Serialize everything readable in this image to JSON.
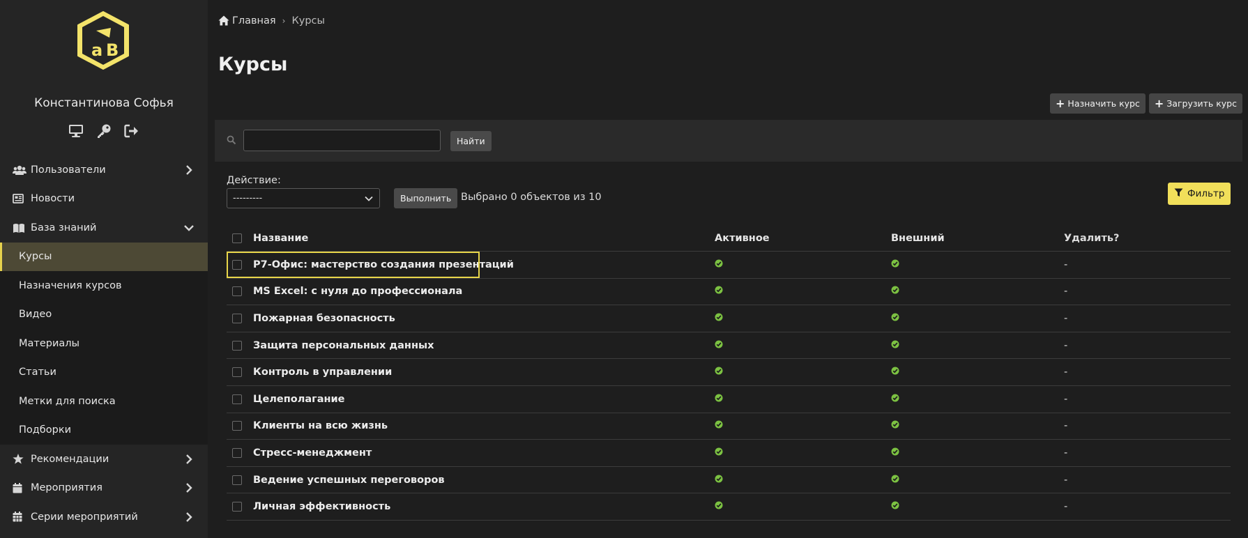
{
  "sidebar": {
    "username": "Константинова Софья",
    "user_icons": [
      "desktop-icon",
      "key-icon",
      "sign-out-icon"
    ],
    "items_top": [
      {
        "label": "Пользователи",
        "icon": "users-icon",
        "chevron": "right"
      },
      {
        "label": "Новости",
        "icon": "newspaper-icon",
        "chevron": ""
      },
      {
        "label": "База знаний",
        "icon": "book-icon",
        "chevron": "down"
      }
    ],
    "sub_items": [
      {
        "label": "Курсы",
        "active": true
      },
      {
        "label": "Назначения курсов",
        "active": false
      },
      {
        "label": "Видео",
        "active": false
      },
      {
        "label": "Материалы",
        "active": false
      },
      {
        "label": "Статьи",
        "active": false
      },
      {
        "label": "Метки для поиска",
        "active": false
      },
      {
        "label": "Подборки",
        "active": false
      }
    ],
    "items_bottom": [
      {
        "label": "Рекомендации",
        "icon": "star-icon",
        "chevron": "right"
      },
      {
        "label": "Мероприятия",
        "icon": "calendar-icon",
        "chevron": "right"
      },
      {
        "label": "Серии мероприятий",
        "icon": "calendar-grid-icon",
        "chevron": "right"
      }
    ]
  },
  "breadcrumb": {
    "home": "Главная",
    "separator": "›",
    "current": "Курсы"
  },
  "page_title": "Курсы",
  "actions": {
    "assign_course": "Назначить курс",
    "upload_course": "Загрузить курс"
  },
  "search": {
    "value": "",
    "button": "Найти"
  },
  "bulk": {
    "label": "Действие:",
    "selected_value": "---------",
    "run_button": "Выполнить",
    "selected_text": "Выбрано 0 объектов из 10"
  },
  "filter_button": "Фильтр",
  "table": {
    "columns": [
      "Название",
      "Активное",
      "Внешний",
      "Удалить?"
    ],
    "rows": [
      {
        "name": "Р7-Офис: мастерство создания презентаций",
        "active": true,
        "external": true,
        "delete": "-"
      },
      {
        "name": "MS Excel: с нуля до профессионала",
        "active": true,
        "external": true,
        "delete": "-"
      },
      {
        "name": "Пожарная безопасность",
        "active": true,
        "external": true,
        "delete": "-"
      },
      {
        "name": "Защита персональных данных",
        "active": true,
        "external": true,
        "delete": "-"
      },
      {
        "name": "Контроль в управлении",
        "active": true,
        "external": true,
        "delete": "-"
      },
      {
        "name": "Целеполагание",
        "active": true,
        "external": true,
        "delete": "-"
      },
      {
        "name": "Клиенты на всю жизнь",
        "active": true,
        "external": true,
        "delete": "-"
      },
      {
        "name": "Стресс-менеджмент",
        "active": true,
        "external": true,
        "delete": "-"
      },
      {
        "name": "Ведение успешных переговоров",
        "active": true,
        "external": true,
        "delete": "-"
      },
      {
        "name": "Личная эффективность",
        "active": true,
        "external": true,
        "delete": "-"
      }
    ]
  },
  "colors": {
    "accent": "#e6d24d",
    "active_bg": "#4d4935",
    "check_green": "#7cc242",
    "filter_bg": "#f1df5a"
  }
}
